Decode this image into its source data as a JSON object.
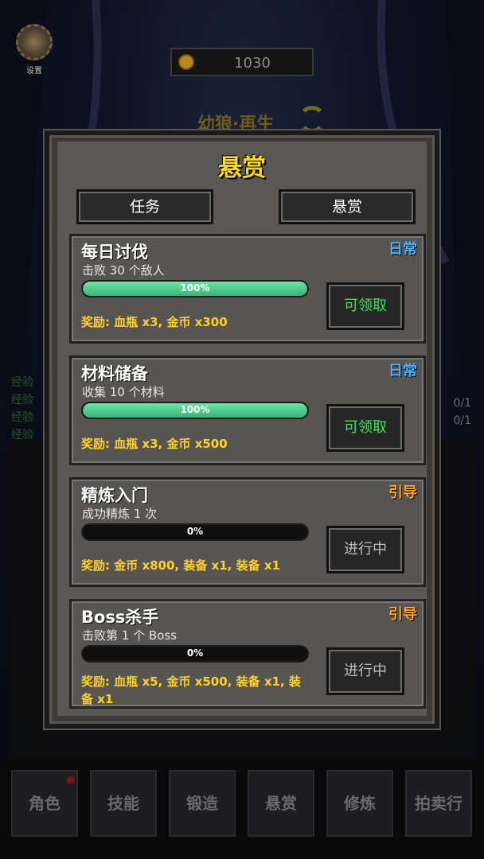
{
  "hud": {
    "settings_label": "设置",
    "coins": "1030",
    "subtitle": "幼狼·再生"
  },
  "side_left": [
    "经验",
    "经验",
    "经验",
    "经验"
  ],
  "side_right": [
    "0/1",
    "0/1"
  ],
  "panel": {
    "title": "悬赏",
    "tabs": [
      "任务",
      "悬赏"
    ],
    "cards": [
      {
        "title": "每日讨伐",
        "tag": "日常",
        "tag_color": "#4fb4ff",
        "desc": "击败 30 个敌人",
        "progress": 1.0,
        "progress_text": "100%",
        "reward": "奖励: 血瓶 x3, 金币 x300",
        "button": "可领取",
        "status": "ready"
      },
      {
        "title": "材料储备",
        "tag": "日常",
        "tag_color": "#4fb4ff",
        "desc": "收集 10 个材料",
        "progress": 1.0,
        "progress_text": "100%",
        "reward": "奖励: 血瓶 x3, 金币 x500",
        "button": "可领取",
        "status": "ready"
      },
      {
        "title": "精炼入门",
        "tag": "引导",
        "tag_color": "#ffa329",
        "desc": "成功精炼 1 次",
        "progress": 0.0,
        "progress_text": "0%",
        "reward": "奖励: 金币 x800, 装备 x1, 装备 x1",
        "button": "进行中",
        "status": "pending"
      },
      {
        "title": "Boss杀手",
        "tag": "引导",
        "tag_color": "#ffa329",
        "desc": "击败第 1 个 Boss",
        "progress": 0.0,
        "progress_text": "0%",
        "reward": "奖励: 血瓶 x5, 金币 x500, 装备 x1, 装备 x1",
        "button": "进行中",
        "status": "pending"
      }
    ]
  },
  "bottom_nav": [
    "角色",
    "技能",
    "锻造",
    "悬赏",
    "修炼",
    "拍卖行"
  ]
}
